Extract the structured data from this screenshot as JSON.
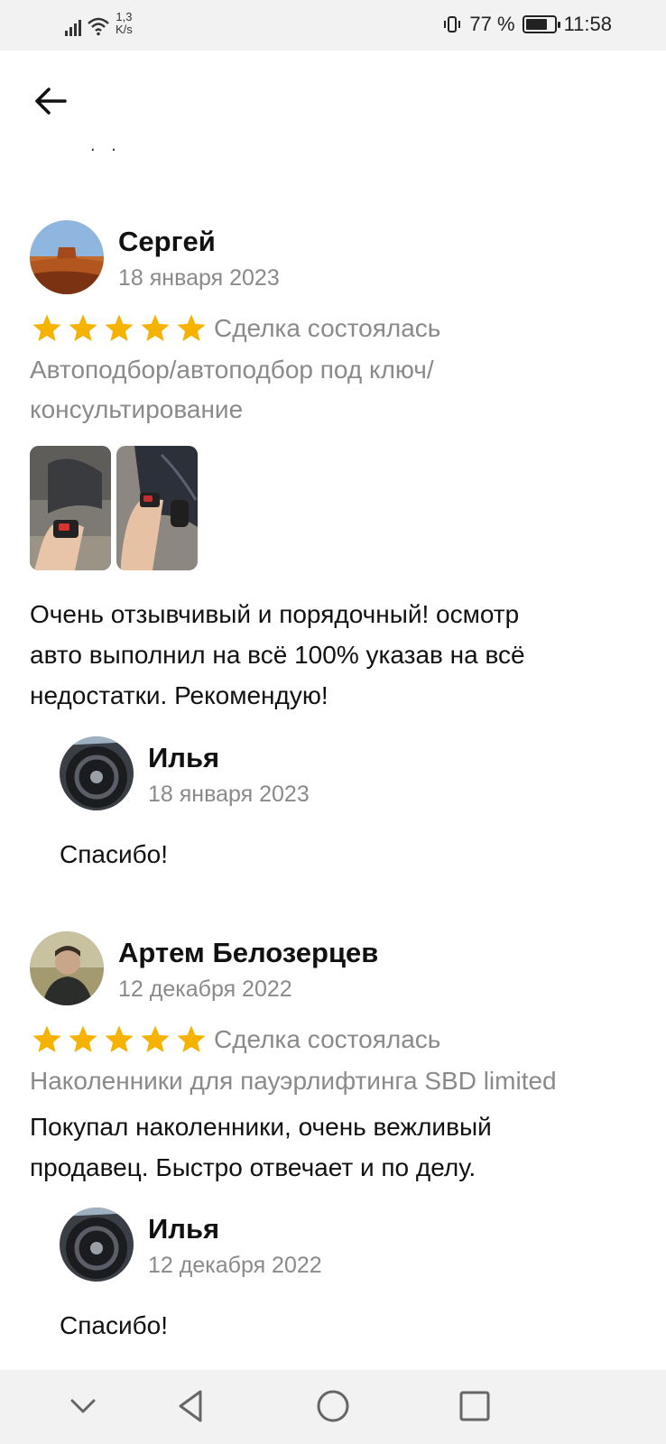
{
  "status_bar": {
    "speed_value": "1,3",
    "speed_unit": "K/s",
    "battery_text": "77 %",
    "battery_level": 0.77,
    "time": "11:58"
  },
  "header": {
    "back_icon": "arrow-left-icon",
    "dots": ". ."
  },
  "reviews": [
    {
      "author": "Сергей",
      "date": "18 января 2023",
      "rating": 5,
      "deal_status": "Сделка состоялась",
      "category_line1": "Автоподбор/автоподбор под ключ/",
      "category_line2": "консультирование",
      "photo_count": 2,
      "text_line1": "Очень отзывчивый и порядочный! осмотр",
      "text_line2": "авто выполнил на всё 100%  указав на всё",
      "text_line3": "недостатки. Рекомендую!",
      "reply": {
        "author": "Илья",
        "date": "18 января 2023",
        "text": "Спасибо!"
      }
    },
    {
      "author": "Артем Белозерцев",
      "date": "12 декабря 2022",
      "rating": 5,
      "deal_status": "Сделка состоялась",
      "category_line1": "Наколенники для пауэрлифтинга SBD limited",
      "text_line1": "Покупал наколенники, очень вежливый",
      "text_line2": "продавец. Быстро отвечает и по делу.",
      "reply": {
        "author": "Илья",
        "date": "12 декабря 2022",
        "text": "Спасибо!"
      }
    }
  ],
  "colors": {
    "star": "#f5b300",
    "muted": "#8a8a8a",
    "bars": "#f2f2f2"
  },
  "nav": {
    "icons": [
      "chevron-down-icon",
      "back-triangle-icon",
      "home-circle-icon",
      "recents-square-icon"
    ]
  }
}
